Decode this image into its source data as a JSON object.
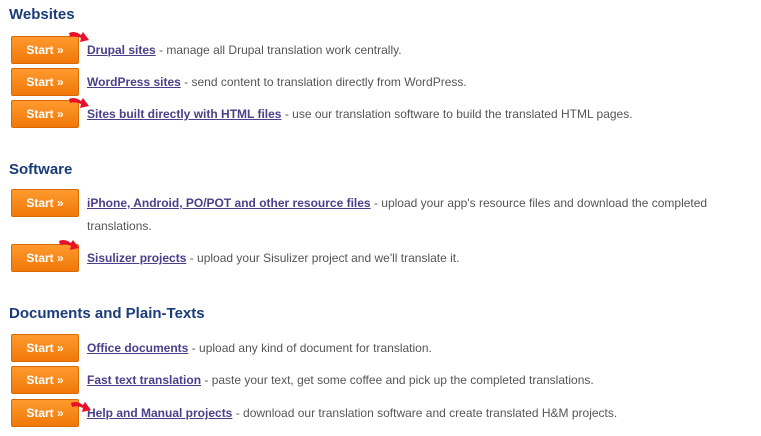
{
  "sections": [
    {
      "title": "Websites",
      "items": [
        {
          "button": "Start »",
          "link": "Drupal sites",
          "desc": " - manage all Drupal translation work centrally."
        },
        {
          "button": "Start »",
          "link": "WordPress sites",
          "desc": " - send content to translation directly from WordPress."
        },
        {
          "button": "Start »",
          "link": "Sites built directly with HTML files",
          "desc": " - use our translation software to build the translated HTML pages."
        }
      ]
    },
    {
      "title": "Software",
      "items": [
        {
          "button": "Start »",
          "link": "iPhone, Android, PO/POT and other resource files",
          "desc": " - upload your app's resource files and download the completed translations."
        },
        {
          "button": "Start »",
          "link": "Sisulizer projects",
          "desc": " - upload your Sisulizer project and we'll translate it."
        }
      ]
    },
    {
      "title": "Documents and Plain-Texts",
      "items": [
        {
          "button": "Start »",
          "link": "Office documents",
          "desc": " - upload any kind of document for translation."
        },
        {
          "button": "Start »",
          "link": "Fast text translation",
          "desc": " - paste your text, get some coffee and pick up the completed translations."
        },
        {
          "button": "Start »",
          "link": "Help and Manual projects",
          "desc": " - download our translation software and create translated H&M projects."
        }
      ]
    }
  ],
  "colors": {
    "title": "#1a3c78",
    "button": "#f58a1f",
    "link": "#4a3f8a",
    "pointer": "#e8102a"
  }
}
